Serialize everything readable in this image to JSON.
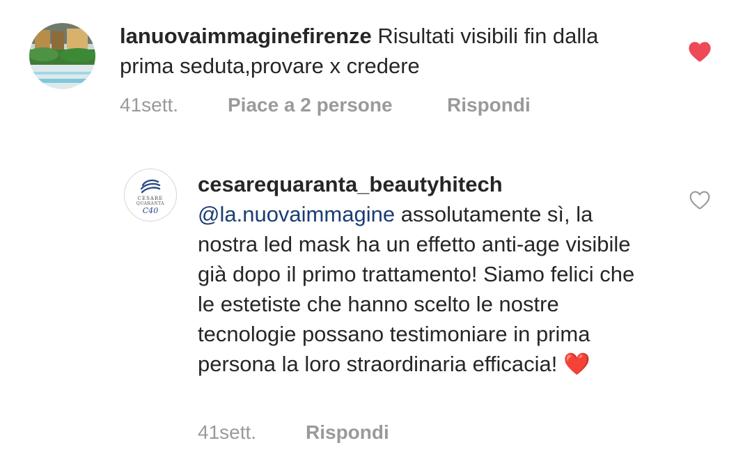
{
  "comments": [
    {
      "username": "lanuovaimmaginefirenze",
      "text": "Risultati visibili fin dalla prima seduta,provare x credere",
      "time": "41sett.",
      "likes_label": "Piace a 2 persone",
      "reply_label": "Rispondi",
      "liked": true,
      "like_icon": "heart-filled-icon",
      "like_color": "#ed4956"
    },
    {
      "username": "cesarequaranta_beautyhitech",
      "mention": "@la.nuovaimmagine",
      "text": "assolutamente sì, la nostra led mask ha un effetto anti-age visibile già dopo il primo trattamento! Siamo felici che le estetiste che hanno scelto le nostre tecnologie possano testimoniare in prima persona la loro straordinaria efficacia! ❤️",
      "time": "41sett.",
      "reply_label": "Rispondi",
      "liked": false,
      "like_icon": "heart-outline-icon",
      "avatar_logo_text": "CESARE QUARANTA C40"
    }
  ],
  "colors": {
    "text": "#262626",
    "meta": "#9a9a9a",
    "mention": "#1a3d73",
    "like": "#ed4956"
  }
}
